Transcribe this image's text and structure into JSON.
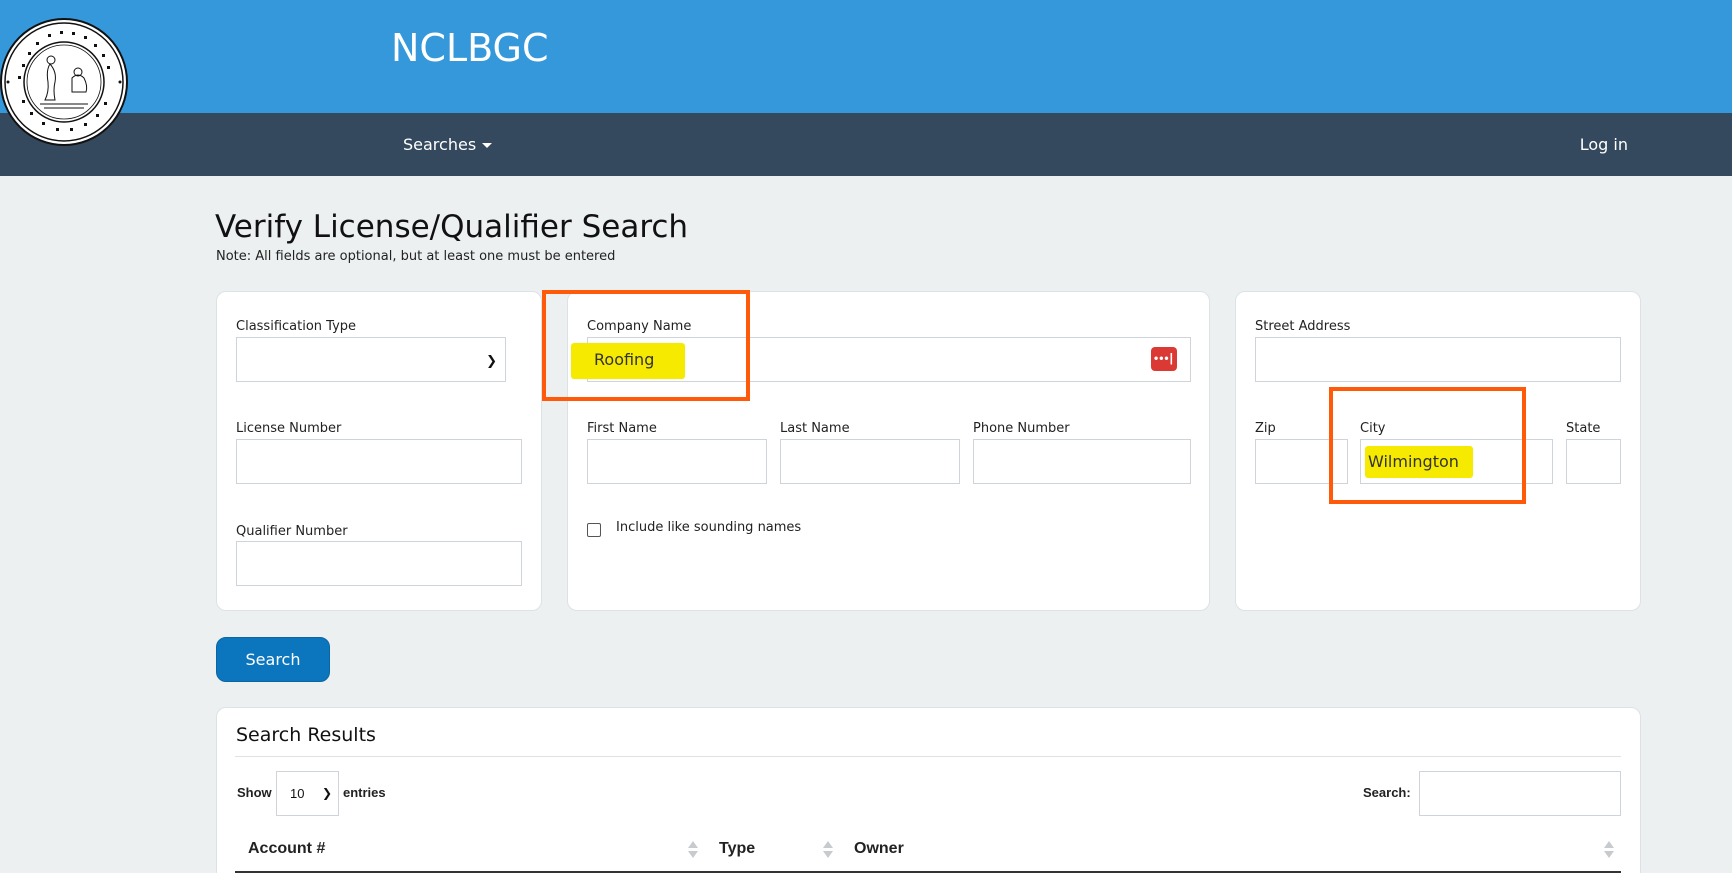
{
  "header": {
    "site_title": "NCLBGC",
    "nav": {
      "searches_label": "Searches",
      "login_label": "Log in"
    }
  },
  "page": {
    "title": "Verify License/Qualifier Search",
    "note": "Note: All fields are optional, but at least one must be entered"
  },
  "form": {
    "classification_type_label": "Classification Type",
    "classification_type_value": "",
    "license_number_label": "License Number",
    "license_number_value": "",
    "qualifier_number_label": "Qualifier Number",
    "qualifier_number_value": "",
    "company_name_label": "Company Name",
    "company_name_value": "Roofing",
    "first_name_label": "First Name",
    "last_name_label": "Last Name",
    "phone_number_label": "Phone Number",
    "like_sounding_label": "Include like sounding names",
    "street_address_label": "Street Address",
    "zip_label": "Zip",
    "city_label": "City",
    "city_value": "Wilmington",
    "state_label": "State",
    "search_button_label": "Search"
  },
  "results": {
    "title": "Search Results",
    "show_label": "Show",
    "entries_value": "10",
    "entries_label": "entries",
    "search_label": "Search:",
    "columns": [
      "Account #",
      "Type",
      "Owner"
    ]
  },
  "colors": {
    "header_bg": "#3498db",
    "navbar_bg": "#34495e",
    "page_bg": "#ecf0f1",
    "button_bg": "#0b76bd",
    "highlight": "#f5ea00",
    "annotation_box": "#ff5a0a"
  }
}
